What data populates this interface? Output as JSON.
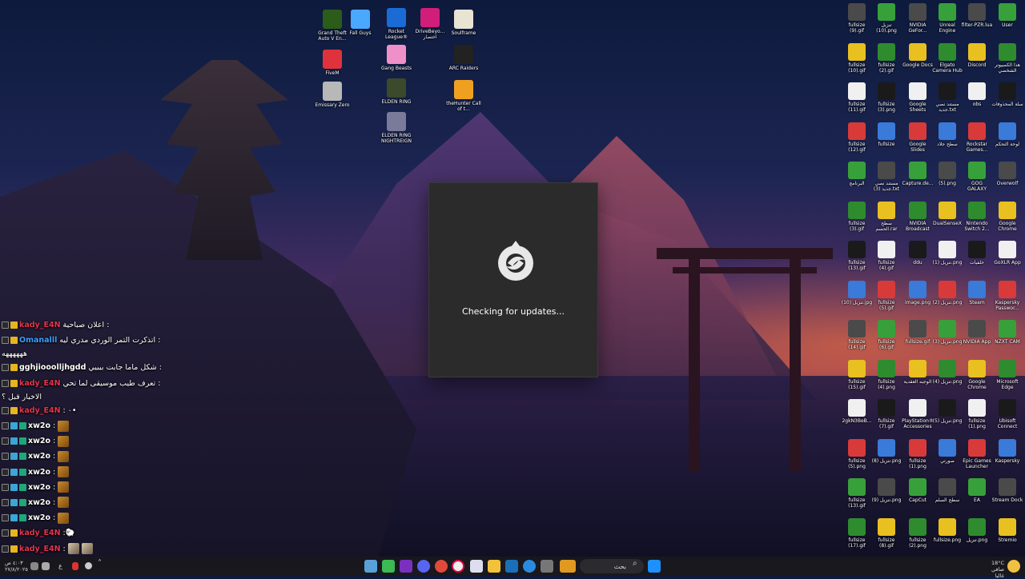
{
  "dialog": {
    "status_text": "Checking for updates..."
  },
  "chat": [
    {
      "name": "kady_E4N",
      "color": "#e4344b",
      "message": "اعلان صباحية :"
    },
    {
      "name": "Omanalll",
      "color": "#3aa0ff",
      "message": "اتذكرت التمر الوردي مدري ليه :"
    },
    {
      "name": "",
      "color": "#ffffff",
      "message": "ههههههه"
    },
    {
      "name": "gghjiooolljhgdd",
      "color": "#ffffff",
      "message": "شكل ماما جابت بيبيي :"
    },
    {
      "name": "kady_E4N",
      "color": "#e4344b",
      "message": "تعرف طيب موسيقى لما تحي :"
    },
    {
      "name": "",
      "color": "#ffffff",
      "message": "الاخبار قبل ؟"
    },
    {
      "name": "kady_E4N",
      "color": "#e4344b",
      "message": ": ٠•"
    },
    {
      "name": "xw2o",
      "color": "#ffffff",
      "message": ":"
    },
    {
      "name": "xw2o",
      "color": "#ffffff",
      "message": ":"
    },
    {
      "name": "xw2o",
      "color": "#ffffff",
      "message": ":"
    },
    {
      "name": "xw2o",
      "color": "#ffffff",
      "message": ":"
    },
    {
      "name": "xw2o",
      "color": "#ffffff",
      "message": ":"
    },
    {
      "name": "xw2o",
      "color": "#ffffff",
      "message": ":"
    },
    {
      "name": "xw2o",
      "color": "#ffffff",
      "message": ":"
    },
    {
      "name": "kady_E4N",
      "color": "#e4344b",
      "message": ":"
    },
    {
      "name": "kady_E4N",
      "color": "#e4344b",
      "message": ":"
    }
  ],
  "desktop_left": [
    {
      "label": "Grand Theft Auto V En...",
      "color": "#2b5c1a"
    },
    {
      "label": "Fall Guys",
      "color": "#4aa8ff"
    },
    {
      "label": "Rocket League®",
      "color": "#1a6bd6"
    },
    {
      "label": "DriveBeyo... اختصار",
      "color": "#d01e7a"
    },
    {
      "label": "Soulframe",
      "color": "#e8e3d2"
    },
    {
      "label": "FiveM",
      "color": "#e0323c"
    },
    {
      "label": "Gang Beasts",
      "color": "#f090c8"
    },
    {
      "label": "ARC Raiders",
      "color": "#222222"
    },
    {
      "label": "Emissary Zero",
      "color": "#b8b8b8"
    },
    {
      "label": "ELDEN RING",
      "color": "#3a4a2a"
    },
    {
      "label": "theHunter Call of t...",
      "color": "#f0a020"
    },
    {
      "label": "ELDEN RING NIGHTREIGN",
      "color": "#7a7a9a"
    }
  ],
  "desktop_right": [
    "fullsize (9).gif",
    "تنزيل (10).png",
    "NVIDIA GeFor...",
    "Unreal Engine",
    "filter-PZR.lua",
    "User",
    "fullsize (10).gif",
    "fullsize (2).gif",
    "Google Docs",
    "Elgato Camera Hub",
    "Discord",
    "هذا الكمبيوتر الشخصي",
    "fullsize (11).gif",
    "fullsize (3).png",
    "Google Sheets",
    "مستند نصي جديد.txt",
    "obs",
    "سلة المحذوفات",
    "fullsize (12).gif",
    "fullsize",
    "Google Slides",
    "سطح جلاد",
    "Rockstar Games...",
    "لوحة التحكم",
    "البرنامج",
    "مستند نصي جديد (3).txt",
    "Capture.de...",
    "(5).png",
    "GOG GALAXY",
    "Overwolf",
    "fullsize (3).gif",
    "سطح الحسم.rar",
    "NVIDIA Broadcast",
    "DualSenseX",
    "Nintendo Switch 2...",
    "Google Chrome",
    "fullsize (13).gif",
    "fullsize (4).gif",
    "ddu",
    "تنزيل (1).png",
    "خلفيات",
    "GoXLR App",
    "تنزيل (10).jpg",
    "fullsize (5).gif",
    "image.png",
    "تنزيل (2).png",
    "Steam",
    "Kaspersky Passwor...",
    "fullsize (14).gif",
    "fullsize (6).gif",
    "fullsize.gif",
    "تنزيل (3).png",
    "NVIDIA App",
    "NZXT CAM",
    "fullsize (15).gif",
    "fullsize (4).png",
    "الوجبه العقدية",
    "تنزيل (4).png",
    "Google Chrome",
    "Microsoft Edge",
    "2gkN3BeB...",
    "fullsize (7).gif",
    "PlayStation® Accessories",
    "تنزيل (5).png",
    "fullsize (1).png",
    "Ubisoft Connect",
    "fullsize (5).png",
    "تنزيل (8).png",
    "fullsize (1).png",
    "صورتي",
    "Epic Games Launcher",
    "Kaspersky",
    "fullsize (13).gif",
    "تنزيل (9).png",
    "CapCut",
    "سطح السلم",
    "EA",
    "Stream Dock",
    "fullsize (17).gif",
    "fullsize (8).gif",
    "fullsize (2).png",
    "fullsize.png",
    "تنزيل.png",
    "Stremio"
  ],
  "taskbar": {
    "search_label": "بحث",
    "weather": "18°C",
    "weather_desc": "صافي غالبا",
    "time": "٤:٠٣ ص",
    "date": "٢٧/٨/٢٠٢٥",
    "lang": "ع"
  }
}
